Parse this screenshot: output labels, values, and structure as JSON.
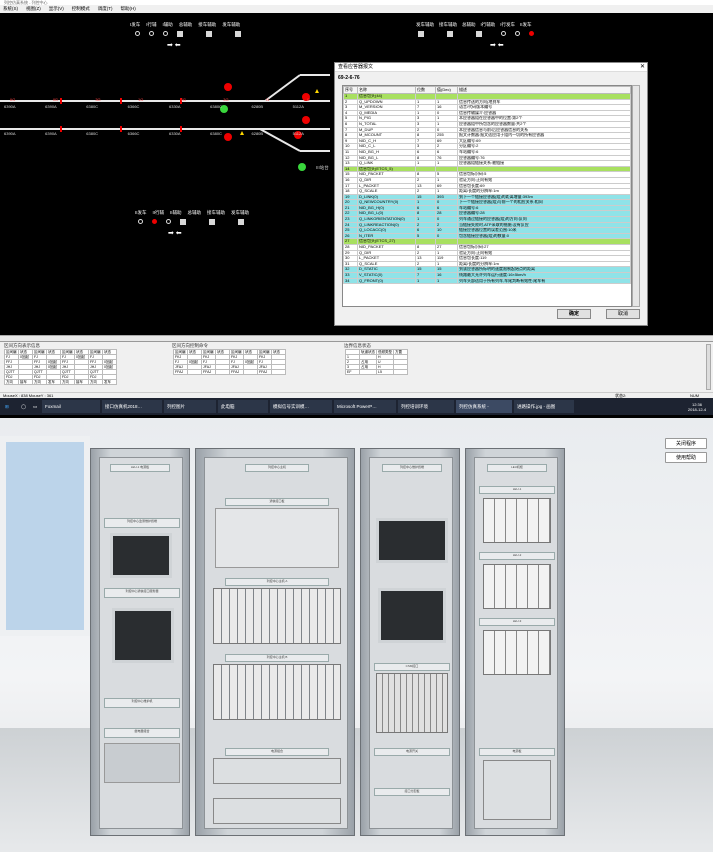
{
  "window": {
    "title": "列控仿真系统 - 列控中心"
  },
  "menu": [
    "系统(S)",
    "视图(Z)",
    "显示(V)",
    "控制模式",
    "调度(T)",
    "帮助(H)"
  ],
  "station": {
    "top_left_labels": [
      "I发车",
      "I行辅",
      "I辅助",
      "总辅助",
      "接车辅助",
      "发车辅助"
    ],
    "top_right_labels": [
      "发车辅助",
      "接车辅助",
      "总辅助",
      "I行辅助",
      "I行发车",
      "II发车"
    ],
    "mid_left_labels": [
      "II发车",
      "II行辅",
      "II辅助",
      "总辅助",
      "接车辅助",
      "发车辅助"
    ],
    "track_labels_row1": [
      "IIG",
      "IIG",
      "3G",
      "1G",
      "2G",
      "3G",
      "I1",
      "I2",
      "3G",
      "4G",
      "II"
    ],
    "track_labels_row2": [
      "6390A",
      "6390A",
      "6380C",
      "6366C",
      "6330A",
      "6380C",
      "6280B",
      "5112A",
      "5116B",
      "I",
      "II"
    ],
    "platform_label": "III站台"
  },
  "dialog": {
    "title": "查看应答器报文",
    "close": "✕",
    "code": "69-2-6-76",
    "columns": [
      "序号",
      "名称",
      "位数",
      "值(Dec)",
      "描述"
    ],
    "rows": [
      [
        "1",
        "信息包头(44)",
        "",
        "",
        ""
      ],
      [
        "2",
        "Q_UPDOWN",
        "1",
        "1",
        "信息传送的方向(地到车"
      ],
      [
        "3",
        "M_VERSION",
        "7",
        "16",
        "语言/代码版本编号"
      ],
      [
        "4",
        "Q_MEDIA",
        "1",
        "0",
        "信息传输媒介:应答器"
      ],
      [
        "5",
        "N_PIG",
        "3",
        "1",
        "本应答器组在应答器中的位置:第2个"
      ],
      [
        "6",
        "N_TOTAL",
        "3",
        "1",
        "应答器组中所包含的应答器数量:共2个"
      ],
      [
        "7",
        "M_DUP",
        "2",
        "0",
        "本应答器信息与前/后应答器信息的关系"
      ],
      [
        "8",
        "M_MCOUNT",
        "8",
        "255",
        "报文计数器:报文适应用于组内一切的所有应答器"
      ],
      [
        "9",
        "NID_C_H",
        "7",
        "69",
        "大区编号:69"
      ],
      [
        "10",
        "NID_C_L",
        "3",
        "2",
        "分区编号:2"
      ],
      [
        "11",
        "NID_BG_H",
        "6",
        "6",
        "车站编号:6"
      ],
      [
        "12",
        "NID_BG_L",
        "8",
        "76",
        "应答器编号:76"
      ],
      [
        "13",
        "Q_LINK",
        "1",
        "1",
        "应答器组链接关系:被链接"
      ],
      [
        "14",
        "信息包头(ETCS_5)",
        "",
        "",
        ""
      ],
      [
        "15",
        "NID_PACKET",
        "8",
        "5",
        "信息包标识码:5"
      ],
      [
        "16",
        "Q_DIR",
        "2",
        "1",
        "验证方向:正向有效"
      ],
      [
        "17",
        "L_PACKET",
        "13",
        "69",
        "信息包长度:69"
      ],
      [
        "18",
        "Q_SCALE",
        "2",
        "1",
        "距离/长度的分辨率:1m"
      ],
      [
        "19",
        "D_LINK(0)",
        "15",
        "393",
        "到下一个链接应答器(组)的距离增量:393m"
      ],
      [
        "20",
        "Q_NEWCOUNTRY(0)",
        "1",
        "0",
        "下一个链接应答器(组)与前一个的相应关系:相同"
      ],
      [
        "21",
        "NID_BG_H(0)",
        "6",
        "6",
        "车站编号:6"
      ],
      [
        "22",
        "NID_BG_L(0)",
        "8",
        "28",
        "应答器编号:28"
      ],
      [
        "23",
        "Q_LINKORIENTATION(0)",
        "1",
        "0",
        "列车通过链接的应答器(组)的方向:反向"
      ],
      [
        "24",
        "Q_LINKREACTION(0)",
        "2",
        "2",
        "当链接失败时,ATP采取的措施:没有反应"
      ],
      [
        "25",
        "Q_LOCACC(0)",
        "6",
        "10",
        "链接应答器位置的误差范围:10米"
      ],
      [
        "26",
        "N_ITER",
        "5",
        "0",
        "包含链接应答器(组)的数量:0"
      ],
      [
        "27",
        "信息包头(ETCS_27)",
        "",
        "",
        ""
      ],
      [
        "28",
        "NID_PACKET",
        "8",
        "27",
        "信息包标识码:27"
      ],
      [
        "29",
        "Q_DIR",
        "2",
        "1",
        "验证方向:正向有效"
      ],
      [
        "30",
        "L_PACKET",
        "13",
        "119",
        "信息包长度:119"
      ],
      [
        "31",
        "Q_SCALE",
        "2",
        "1",
        "距离/长度的分辨率:1m"
      ],
      [
        "32",
        "D_STATIC",
        "15",
        "15",
        "到该应答器所标明的速度限制起始点的距离"
      ],
      [
        "33",
        "V_STATIC(0)",
        "7",
        "16",
        "线路最大允许列车运行速度:16×5km/h"
      ],
      [
        "34",
        "Q_FRONT(0)",
        "1",
        "1",
        "列车头部适用于所有列车,车尾判断有效性:尾车有"
      ]
    ],
    "ok": "确定",
    "cancel": "取消"
  },
  "panels": {
    "p1": {
      "title": "区间方向表示信息",
      "headers": [
        "区间编",
        "状态",
        "区间编",
        "状态",
        "区间编",
        "状态",
        "区间编",
        "状态"
      ],
      "rows": [
        [
          "FJ",
          "0回起",
          "FJ",
          "",
          "FJ",
          "0回起",
          "FJ",
          ""
        ],
        [
          "FFJ",
          "",
          "FFJ",
          "0回起",
          "FFJ",
          "",
          "FFJ",
          "0回起"
        ],
        [
          "JHJ",
          "",
          "JHJ",
          "0回起",
          "JHJ",
          "",
          "JHJ",
          "0回起"
        ],
        [
          "QJTT",
          "",
          "QJTT",
          "",
          "QJTT",
          "",
          "QJTT",
          ""
        ],
        [
          "FDJ",
          "",
          "FDJ",
          "",
          "FDJ",
          "",
          "FDJ",
          ""
        ],
        [
          "方向",
          "接车",
          "方向",
          "发车",
          "方向",
          "接车",
          "方向",
          "发车"
        ]
      ]
    },
    "p2": {
      "title": "区间方向控制命令",
      "headers": [
        "区间编",
        "状态",
        "区间编",
        "状态",
        "区间编",
        "状态",
        "区间编",
        "状态"
      ],
      "rows": [
        [
          "FKJ",
          "",
          "FKJ",
          "",
          "FKJ",
          "",
          "FKJ",
          ""
        ],
        [
          "FJ",
          "0回起",
          "FJ",
          "",
          "FJ",
          "0回起",
          "FJ",
          ""
        ],
        [
          "JFAJ",
          "",
          "JFAJ",
          "",
          "JFAJ",
          "",
          "JFAJ",
          ""
        ],
        [
          "FFAJ",
          "",
          "FFAJ",
          "",
          "FFAJ",
          "",
          "FFAJ",
          ""
        ]
      ]
    },
    "p3": {
      "title": "边界信息状态",
      "headers": [
        "",
        "轨道状态",
        "低频类型",
        "方置"
      ],
      "rows": [
        [
          "1",
          "",
          "H",
          ""
        ],
        [
          "2",
          "占用",
          "U",
          ""
        ],
        [
          "3",
          "占用",
          "H",
          ""
        ],
        [
          "EF",
          "",
          "L5",
          ""
        ]
      ]
    }
  },
  "statusbar": {
    "left": "MouseX : 838   MouseY : 361",
    "mid": "状态2:",
    "right1": "NUM"
  },
  "taskbar": {
    "items": [
      "Foxmail",
      "接口仿真机2018…",
      "列控图片",
      "此电脑",
      "模拟信号实训模…",
      "Microsoft PowerP…",
      "列控培训环境",
      "列控仿真系统 -",
      "进路操作.jpg - 画图"
    ],
    "time": "12:36",
    "date": "2018-12-4"
  },
  "room": {
    "buttons": {
      "exit": "关闭程序",
      "help": "使用帮助"
    },
    "cab1": {
      "plates": [
        "LEU-1 电源板",
        "列控中心监测维护终端",
        "列控中心通信接口服务器",
        "列控中心维护机",
        "继电器组合"
      ]
    },
    "cab2": {
      "plates": [
        "列控中心主机",
        "通信接口板",
        "列控中心主机 A",
        "列控中心主机 B",
        "电源组合"
      ]
    },
    "cab3": {
      "plates": [
        "列控中心维护终端",
        "CSM接口",
        "电源开关",
        "接口分配板"
      ]
    },
    "cab4": {
      "plates": [
        "LEU机柜",
        "LEU-1",
        "LEU-2",
        "LEU-3",
        "电源板"
      ]
    }
  }
}
